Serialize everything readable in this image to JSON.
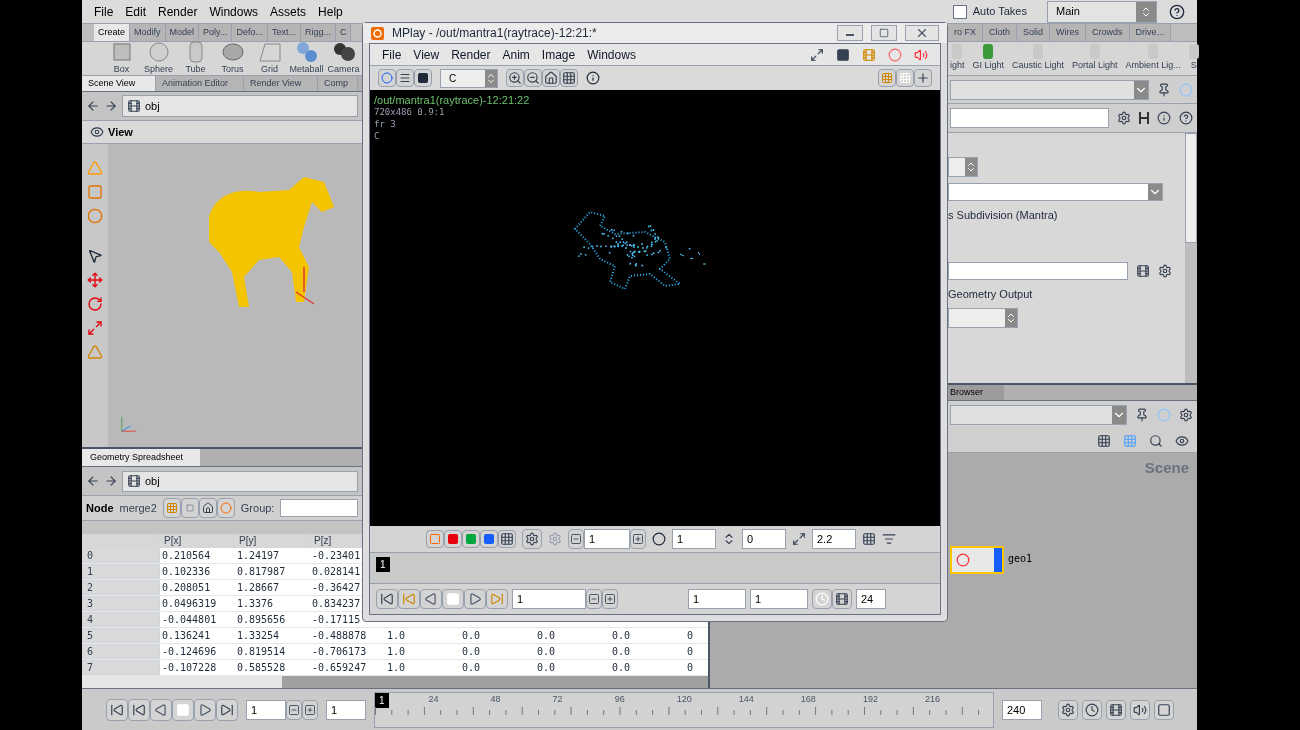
{
  "menu": [
    "File",
    "Edit",
    "Render",
    "Windows",
    "Assets",
    "Help"
  ],
  "auto_takes": {
    "label": "Auto Takes",
    "checked": false
  },
  "desktop": {
    "value": "Main"
  },
  "shelf": {
    "tabs_left": [
      {
        "label": "Create",
        "selected": true
      },
      {
        "label": "Modify",
        "selected": false
      },
      {
        "label": "Model",
        "selected": false
      },
      {
        "label": "Poly...",
        "selected": false
      },
      {
        "label": "Defo...",
        "selected": false
      },
      {
        "label": "Text...",
        "selected": false
      },
      {
        "label": "Rigg...",
        "selected": false
      },
      {
        "label": "C",
        "selected": false
      }
    ],
    "tabs_right": [
      {
        "label": "ro FX",
        "selected": false
      },
      {
        "label": "Cloth",
        "selected": false
      },
      {
        "label": "Solid",
        "selected": false
      },
      {
        "label": "Wires",
        "selected": false
      },
      {
        "label": "Crowds",
        "selected": false
      },
      {
        "label": "Drive...",
        "selected": false
      }
    ],
    "tools_left": [
      "Box",
      "Sphere",
      "Tube",
      "Torus",
      "Grid",
      "Metaball",
      "Camera"
    ],
    "tools_right": [
      "ight",
      "GI Light",
      "Caustic Light",
      "Portal Light",
      "Ambient Lig...",
      "S"
    ]
  },
  "scene_view": {
    "tabs": [
      {
        "label": "Scene View",
        "selected": true
      },
      {
        "label": "Animation Editor",
        "selected": false
      },
      {
        "label": "Render View",
        "selected": false
      },
      {
        "label": "Comp",
        "selected": false
      }
    ],
    "path": "obj",
    "title": "View"
  },
  "spreadsheet": {
    "tab": "Geometry Spreadsheet",
    "path": "obj",
    "node_label": "Node",
    "node": "merge2",
    "group_label": "Group:",
    "columns": [
      "P[x]",
      "P[y]",
      "P[z]"
    ],
    "rows": [
      {
        "index": "0",
        "cells": [
          "0.210564",
          "1.24197",
          "-0.23401"
        ]
      },
      {
        "index": "1",
        "cells": [
          "0.102336",
          "0.817987",
          "0.028141"
        ]
      },
      {
        "index": "2",
        "cells": [
          "0.208051",
          "1.28667",
          "-0.36427"
        ]
      },
      {
        "index": "3",
        "cells": [
          "0.0496319",
          "1.3376",
          "0.834237"
        ]
      },
      {
        "index": "4",
        "cells": [
          "-0.044801",
          "0.895656",
          "-0.17115"
        ]
      },
      {
        "index": "5",
        "cells": [
          "0.136241",
          "1.33254",
          "-0.488878",
          "1.0",
          "0.0",
          "0.0",
          "0.0",
          "0"
        ]
      },
      {
        "index": "6",
        "cells": [
          "-0.124696",
          "0.819514",
          "-0.706173",
          "1.0",
          "0.0",
          "0.0",
          "0.0",
          "0"
        ]
      },
      {
        "index": "7",
        "cells": [
          "-0.107228",
          "0.585528",
          "-0.659247",
          "1.0",
          "0.0",
          "0.0",
          "0.0",
          "0"
        ]
      }
    ]
  },
  "parameters": {
    "renderer_label": "s Subdivision (Mantra)",
    "section_label": "Geometry Output"
  },
  "network": {
    "tab": "Browser",
    "context": "Scene",
    "node": "geo1"
  },
  "mplay": {
    "title": "MPlay - /out/mantra1(raytrace)-12:21:*",
    "menu": [
      "File",
      "View",
      "Render",
      "Anim",
      "Image",
      "Windows"
    ],
    "channel": "C",
    "overlay": [
      "/out/mantra1(raytrace)-12:21:22",
      "720x486  0.9:1",
      "fr 3",
      "C"
    ],
    "fields": [
      "1",
      "1",
      "0",
      "2.2"
    ],
    "frame_marker": "1",
    "playback": {
      "frame": "1",
      "start": "1",
      "end": "1",
      "fps": "24"
    }
  },
  "timeline": {
    "frame": "1",
    "start": "1",
    "marker": "1",
    "ticks": [
      "24",
      "48",
      "72",
      "96",
      "120",
      "144",
      "168",
      "192",
      "216"
    ],
    "end": "240"
  }
}
